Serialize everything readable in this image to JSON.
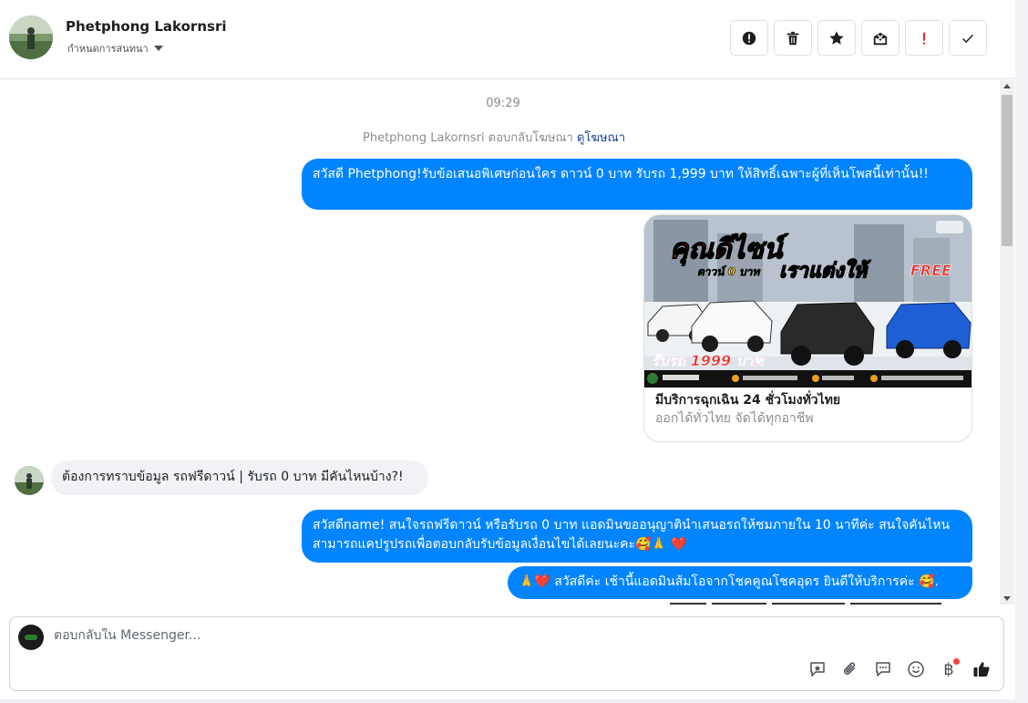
{
  "header": {
    "contact_name": "Phetphong Lakornsri",
    "assign_label": "กำหนดการสนทนา",
    "actions": [
      {
        "name": "mark-spam-button",
        "icon": "alert-circle-icon"
      },
      {
        "name": "delete-button",
        "icon": "trash-icon"
      },
      {
        "name": "star-button",
        "icon": "star-icon"
      },
      {
        "name": "mark-unread-button",
        "icon": "envelope-x-icon"
      },
      {
        "name": "follow-up-button",
        "icon": "exclamation-icon"
      },
      {
        "name": "mark-done-button",
        "icon": "check-icon"
      }
    ]
  },
  "conversation": {
    "timestamp": "09:29",
    "system_text": "Phetphong Lakornsri ตอบกลับโฆษณา",
    "system_link": "ดูโฆษณา",
    "messages": [
      {
        "direction": "out",
        "text": "สวัสดี Phetphong!รับข้อเสนอพิเศษก่อนใคร ดาวน์ 0 บาท รับรถ 1,999 บาท ให้สิทธิ์เฉพาะผู้ที่เห็นโพสนี้เท่านั้น!!"
      },
      {
        "direction": "out",
        "type": "ad-card",
        "ad_image_text": {
          "headline": "คุณดีไซน์",
          "sub": "ดาวน์ 0 บาท",
          "slogan": "เราแต่งให้",
          "free": "FREE",
          "price": "รับรถ 1999 บาท"
        },
        "title": "มีบริการฉุกเฉิน 24 ชั่วโมงทั่วไทย",
        "subtitle": "ออกได้ทั่วไทย จัดได้ทุกอาชีพ"
      },
      {
        "direction": "in",
        "text": "ต้องการทราบข้อมูล รถฟรีดาวน์ | รับรถ 0 บาท มีคันไหนบ้าง?!"
      },
      {
        "direction": "out",
        "text": "สวัสดีname! สนใจรถฟรีดาวน์ หรือรับรถ 0 บาท แอดมินขออนุญาตินำเสนอรถให้ชมภายใน 10 นาทีค่ะ สนใจคันไหนสามารถแคปรูปรถเพื่อตอบกลับรับข้อมูลเงื่อนไขได้เลยนะคะ🥰🙏 ❤️"
      },
      {
        "direction": "out",
        "text": "🙏❤️ สวัสดีค่ะ เช้านี้แอดมินส้มโอจากโชคคูณโชคอุดร ยินดีให้บริการค่ะ  🥰."
      }
    ]
  },
  "composer": {
    "placeholder": "ตอบกลับใน Messenger...",
    "tools": [
      "saved-reply-icon",
      "attachment-icon",
      "quick-reply-icon",
      "emoji-icon",
      "baht-payment-icon",
      "like-icon"
    ],
    "baht_symbol": "฿"
  },
  "colors": {
    "bubble_out": "#0084ff",
    "bubble_in": "#f0f2f5",
    "link": "#1c3f94",
    "alert_red": "#e02e24"
  }
}
